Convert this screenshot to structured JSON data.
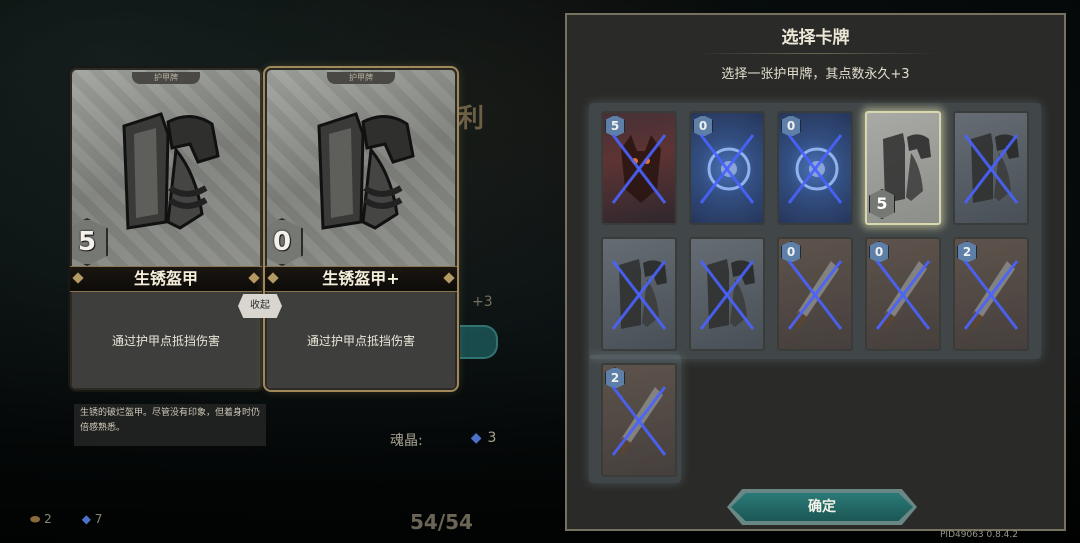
{
  "background": {
    "title_fragment": "利",
    "plus_text": "+3",
    "soul_label": "魂晶:",
    "soul_value": "3",
    "bottom_left_1": "2",
    "bottom_left_2": "7",
    "deck_count": "54/54"
  },
  "preview": {
    "card_type_label": "护甲牌",
    "original": {
      "cost": "5",
      "name": "生锈盔甲",
      "desc": "通过护甲点抵挡伤害"
    },
    "upgraded": {
      "cost": "0",
      "name": "生锈盔甲+",
      "desc": "通过护甲点抵挡伤害"
    },
    "fold_label": "收起",
    "flavor_text": "生锈的破烂盔甲。尽管没有印象，但着身时仍倍感熟悉。"
  },
  "panel": {
    "title": "选择卡牌",
    "subtitle": "选择一张护甲牌，其点数永久+3",
    "confirm_label": "确定",
    "cards": [
      {
        "cost": "5",
        "kind": "red",
        "disabled": true
      },
      {
        "cost": "0",
        "kind": "blue",
        "disabled": true
      },
      {
        "cost": "0",
        "kind": "blue",
        "disabled": true
      },
      {
        "cost": "5",
        "kind": "armor",
        "disabled": false,
        "selected": true
      },
      {
        "cost": "",
        "kind": "armor",
        "disabled": true
      },
      {
        "cost": "",
        "kind": "armor",
        "disabled": true
      },
      {
        "cost": "",
        "kind": "armor",
        "disabled": true
      },
      {
        "cost": "0",
        "kind": "brown",
        "disabled": true
      },
      {
        "cost": "0",
        "kind": "brown",
        "disabled": true
      },
      {
        "cost": "2",
        "kind": "brown",
        "disabled": true
      },
      {
        "cost": "2",
        "kind": "brown",
        "disabled": true
      }
    ]
  },
  "version": "PID49063  0.8.4.2"
}
